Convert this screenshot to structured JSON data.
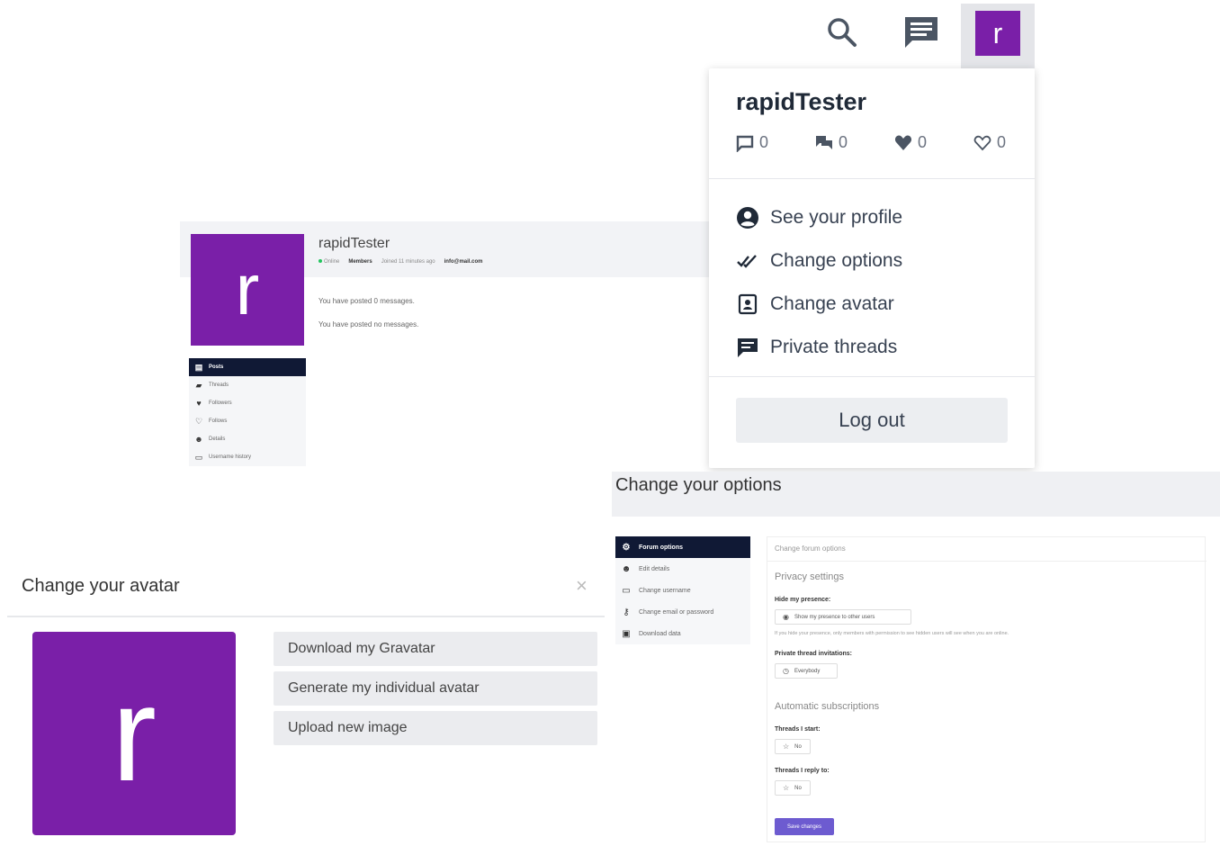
{
  "colors": {
    "avatar_purple": "#7a1fa8",
    "nav_active": "#101935",
    "save_button": "#6d5bd0"
  },
  "navbar": {
    "search_icon": "search-icon",
    "chat_icon": "chat-icon",
    "avatar_initial": "r"
  },
  "dropdown": {
    "username": "rapidTester",
    "stats": [
      {
        "icon": "posts-icon",
        "value": "0"
      },
      {
        "icon": "threads-icon",
        "value": "0"
      },
      {
        "icon": "followers-icon",
        "value": "0"
      },
      {
        "icon": "follows-icon",
        "value": "0"
      }
    ],
    "menu": [
      {
        "icon": "profile-icon",
        "label": "See your profile"
      },
      {
        "icon": "options-icon",
        "label": "Change options"
      },
      {
        "icon": "avatar-icon",
        "label": "Change avatar"
      },
      {
        "icon": "private-threads-icon",
        "label": "Private threads"
      }
    ],
    "logout_label": "Log out"
  },
  "profile": {
    "avatar_initial": "r",
    "username": "rapidTester",
    "meta": {
      "status": "Online",
      "rank": "Members",
      "joined": "Joined 11 minutes ago",
      "email": "info@mail.com"
    },
    "messages": [
      "You have posted 0 messages.",
      "You have posted no messages."
    ],
    "nav": [
      "Posts",
      "Threads",
      "Followers",
      "Follows",
      "Details",
      "Username history"
    ]
  },
  "options": {
    "title": "Change your options",
    "nav": [
      "Forum options",
      "Edit details",
      "Change username",
      "Change email or password",
      "Download data"
    ],
    "form": {
      "header": "Change forum options",
      "privacy_section": "Privacy settings",
      "hide_presence_label": "Hide my presence:",
      "hide_presence_value": "Show my presence to other users",
      "hide_presence_help": "If you hide your presence, only members with permission to see hidden users will see when you are online.",
      "private_thread_label": "Private thread invitations:",
      "private_thread_value": "Everybody",
      "subscriptions_section": "Automatic subscriptions",
      "threads_start_label": "Threads I start:",
      "threads_start_value": "No",
      "threads_reply_label": "Threads I reply to:",
      "threads_reply_value": "No",
      "save_label": "Save changes"
    }
  },
  "avatar": {
    "title": "Change your avatar",
    "close_glyph": "×",
    "avatar_initial": "r",
    "options": [
      "Download my Gravatar",
      "Generate my individual avatar",
      "Upload new image"
    ]
  }
}
